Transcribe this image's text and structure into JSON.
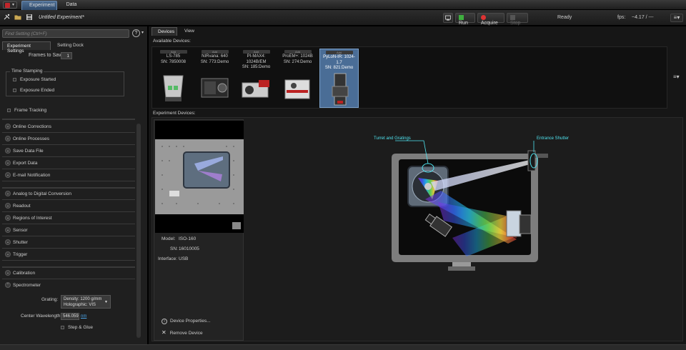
{
  "topbar": {
    "tabs": [
      "Experiment",
      "Data"
    ]
  },
  "toolbar": {
    "experiment_title": "Untitled Experiment*",
    "run_label": "Run",
    "acquire_label": "Acquire",
    "stop_label": "Stop",
    "status": "Ready",
    "fps_label": "fps:",
    "fps_value": "~4.17 / ---"
  },
  "left_panel": {
    "search_placeholder": "Find Setting (Ctrl+F)",
    "tabs": [
      "Experiment Settings",
      "Setting Dock"
    ],
    "frames_to_save_label": "Frames to Save:",
    "frames_to_save_value": "1",
    "time_stamping": {
      "title": "Time Stamping",
      "options": [
        "Exposure Started",
        "Exposure Ended"
      ]
    },
    "frame_tracking": "Frame Tracking",
    "sections_group1": [
      "Online Corrections",
      "Online Processes",
      "Save Data File",
      "Export Data",
      "E-mail Notification"
    ],
    "sections_group2": [
      "Analog to Digital Conversion",
      "Readout",
      "Regions of Interest",
      "Sensor",
      "Shutter",
      "Trigger"
    ],
    "sections_group3": [
      "Calibration",
      "Spectrometer"
    ],
    "spectrometer": {
      "grating_label": "Grating:",
      "grating_line1": "Density: 1200 g/mm",
      "grating_line2": "Holographic: VIS",
      "center_wavelength_label": "Center Wavelength:",
      "center_wavelength_value": "546.059",
      "center_wavelength_unit": "nm",
      "step_glue": "Step & Glue"
    }
  },
  "main": {
    "tabs": [
      "Devices",
      "View"
    ],
    "available_title": "Available Devices:",
    "available_devices": [
      {
        "add": "Add",
        "name": "LS-785",
        "sn": "SN: 7850008",
        "selected": false
      },
      {
        "add": "Add",
        "name": "NIRvana: 640",
        "sn": "SN: 773:Demo",
        "selected": false
      },
      {
        "add": "Add",
        "name": "PI-MAX4: 1024B/EM",
        "sn": "SN: 185:Demo",
        "selected": false
      },
      {
        "add": "Add",
        "name": "ProEM+: 1024B",
        "sn": "SN: 274:Demo",
        "selected": false
      },
      {
        "add": "Add",
        "name": "PyLoN-IR: 1024-1.7",
        "sn": "SN: 821:Demo",
        "selected": true
      }
    ],
    "experiment_devices_title": "Experiment Devices:",
    "device_card": {
      "model_label": "Model:",
      "model_value": "ISO-160",
      "sn_label": "SN:",
      "sn_value": "16010005",
      "interface_label": "Interface:",
      "interface_value": "USB",
      "properties_link": "Device Properties...",
      "remove_link": "Remove Device"
    },
    "schematic": {
      "callout_turret": "Turret and Gratings",
      "callout_shutter": "Entrance Shutter"
    }
  }
}
